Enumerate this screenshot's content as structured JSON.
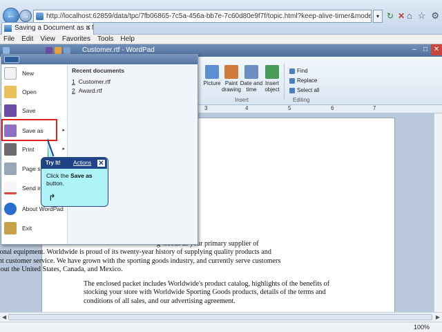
{
  "browser": {
    "url": "http://localhost:62859/data/tpc/7fb06865-7c5a-456a-bb7e-7c60d80e9f7f/topic.html?keep-alive-timer&mode=T&directlaunch",
    "tab_title": "Saving a Document as a Ne...",
    "tab_close": "✕",
    "back_glyph": "←",
    "forward_glyph": "→",
    "refresh_glyph": "↻",
    "stop_glyph": "✕",
    "dropdown_glyph": "▾",
    "toolbar_icons": [
      "⌂",
      "☆",
      "⚙"
    ],
    "menu": [
      "File",
      "Edit",
      "View",
      "Favorites",
      "Tools",
      "Help"
    ]
  },
  "wordpad": {
    "title": "Customer.rtf - WordPad",
    "window_buttons": [
      "–",
      "□",
      "✕"
    ],
    "ribbon": {
      "insert": [
        {
          "label": "Picture",
          "icon": "picture-icon",
          "color": "#5b8fcf"
        },
        {
          "label": "Paint drawing",
          "icon": "paint-icon",
          "color": "#d07a3a"
        },
        {
          "label": "Date and time",
          "icon": "calendar-icon",
          "color": "#6a8fc0"
        },
        {
          "label": "Insert object",
          "icon": "object-icon",
          "color": "#4a9a5a"
        }
      ],
      "insert_label": "Insert",
      "editing": [
        "Find",
        "Replace",
        "Select all"
      ],
      "editing_label": "Editing"
    },
    "ruler": [
      "3",
      "4",
      "5",
      "6",
      "7"
    ],
    "paragraphs": [
      "g Goods as your primary supplier of recreational equipment. Worldwide is proud of its twenty-year history of supplying quality products and excellent customer service. We have grown with the sporting goods industry, and currently serve customers throughout the United States, Canada, and Mexico.",
      "The enclosed packet includes Worldwide's product catalog, highlights of the benefits of stocking your store with Worldwide Sporting Goods products, details of the terms and conditions of all sales, and our advertising agreement."
    ],
    "zoom": "100%"
  },
  "file_menu": {
    "items": [
      {
        "label": "New",
        "icon": "new-icon",
        "color": "#f2f2f2"
      },
      {
        "label": "Open",
        "icon": "open-icon",
        "color": "#e8c15a"
      },
      {
        "label": "Save",
        "icon": "save-icon",
        "color": "#6a4ca5"
      },
      {
        "label": "Save as",
        "icon": "save-as-icon",
        "color": "#8d6fc5",
        "has_submenu": true
      },
      {
        "label": "Print",
        "icon": "print-icon",
        "color": "#6b6b6b",
        "has_submenu": true
      },
      {
        "label": "Page set",
        "icon": "page-setup-icon",
        "color": "#9aa7b5"
      },
      {
        "label": "Send in",
        "icon": "send-icon",
        "color": "#d44"
      },
      {
        "label": "About WordPad",
        "icon": "about-icon",
        "color": "#2a6fd0"
      },
      {
        "label": "Exit",
        "icon": "exit-icon",
        "color": "#c8a24a"
      }
    ],
    "recent_title": "Recent documents",
    "recent": [
      {
        "num": "1",
        "name": "Customer.rtf"
      },
      {
        "num": "2",
        "name": "Award.rtf"
      }
    ],
    "submenu_arrow": "▸"
  },
  "callout": {
    "title": "Try It!",
    "actions": "Actions",
    "close": "✕",
    "text_before": "Click the ",
    "text_bold": "Save as",
    "text_after": " button.",
    "next_glyph": "↱"
  }
}
